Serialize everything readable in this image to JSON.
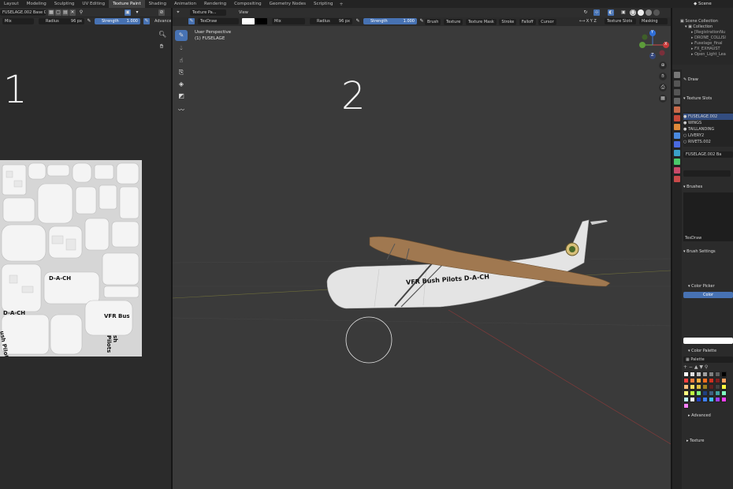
{
  "workspace_tabs": [
    "Layout",
    "Modeling",
    "Sculpting",
    "UV Editing",
    "Texture Paint",
    "Shading",
    "Animation",
    "Rendering",
    "Compositing",
    "Geometry Nodes",
    "Scripting"
  ],
  "active_tab": "Texture Paint",
  "scene_name": "Scene",
  "image_editor": {
    "image_name": "FUSELAGE.002 Base Color",
    "blend": "Mix",
    "radius_label": "Radius",
    "radius_value": "96 px",
    "strength_label": "Strength",
    "strength_value": "1.000",
    "advanced": "Advanced",
    "marker": "1",
    "uv_texts": [
      "D-A-CH",
      "VFR Bus",
      "ush Pilots",
      "D-A-CH",
      "sh Pilots"
    ]
  },
  "viewport": {
    "mode": "Texture Pa...",
    "view_menu": "View",
    "brush_name": "TexDraw",
    "blend": "Mix",
    "radius_label": "Radius",
    "radius_value": "96 px",
    "strength_label": "Strength",
    "strength_value": "1.000",
    "menus": [
      "Brush",
      "Texture",
      "Texture Mask",
      "Stroke",
      "Falloff",
      "Cursor"
    ],
    "texture_slots_btn": "Texture Slots",
    "masking_btn": "Masking",
    "perspective": "User Perspective",
    "object_label": "(1) FUSELAGE",
    "marker": "2",
    "plane_livery": "VFR Bush Pilots D-A-CH",
    "gizmo_axes": [
      "Y",
      "X",
      "Z"
    ],
    "colors": {
      "fuselage": "#e4e4e4",
      "wing": "#a07850",
      "bg": "#3a3a3a"
    }
  },
  "outliner": {
    "scene_collection": "Scene Collection",
    "collection": "Collection",
    "items": [
      "[RegistrationNu",
      "DRONE_COLLISI",
      "Fuselage_final",
      "FX_EXHAUST",
      "Open_Light_Lea"
    ]
  },
  "properties": {
    "tool_name": "Draw",
    "texture_slots_title": "Texture Slots",
    "slots": [
      "FUSELAGE.002",
      "WINGS",
      "TAILLANDING",
      "LIVERY2",
      "RIVETS.002"
    ],
    "active_image": "FUSELAGE.002 Ba",
    "brushes_title": "Brushes",
    "brush_name": "TexDraw",
    "brush_settings_title": "Brush Settings",
    "color_picker_title": "Color Picker",
    "color_btn": "Color",
    "color_palette_title": "Color Palette",
    "palette_name": "Palette",
    "advanced_title": "Advanced",
    "texture_title": "Texture",
    "palette_colors": [
      "#ffffff",
      "#e0e0e0",
      "#c0c0c0",
      "#a0a0a0",
      "#808080",
      "#606060",
      "#000000",
      "#ff4040",
      "#ff8040",
      "#ffb040",
      "#ff7020",
      "#d03020",
      "#802020",
      "#ffa060",
      "#ffc080",
      "#ffe060",
      "#e0c040",
      "#a08020",
      "#602020",
      "#404040",
      "#ffff40",
      "#ffff80",
      "#c0ff40",
      "#80ff80",
      "#204080",
      "#406080",
      "#40a0a0",
      "#80ffc0",
      "#c0ffff",
      "#ffffff",
      "#2040c0",
      "#4080ff",
      "#40c0ff",
      "#a040ff",
      "#ff40ff",
      "#ff80ff"
    ]
  }
}
